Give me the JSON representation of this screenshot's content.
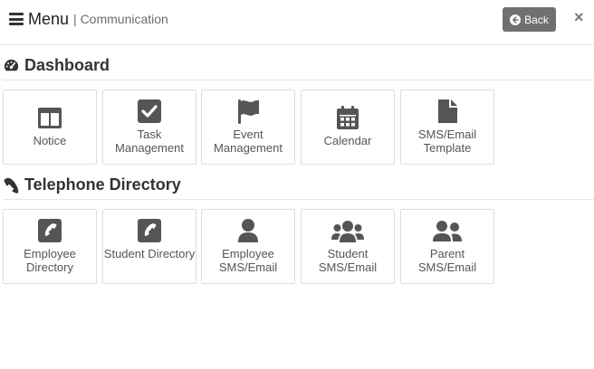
{
  "header": {
    "menu_label": "Menu",
    "separator": "|",
    "subtitle": "Communication",
    "back_label": "Back",
    "close_label": "×"
  },
  "sections": {
    "dashboard": {
      "title": "Dashboard",
      "icon": "tachometer-icon",
      "tiles": [
        {
          "label": "Notice",
          "icon": "columns-icon"
        },
        {
          "label": "Task Management",
          "icon": "check-square-icon"
        },
        {
          "label": "Event Management",
          "icon": "flag-icon"
        },
        {
          "label": "Calendar",
          "icon": "calendar-icon"
        },
        {
          "label": "SMS/Email Template",
          "icon": "file-icon"
        }
      ]
    },
    "directory": {
      "title": "Telephone Directory",
      "icon": "phone-icon",
      "tiles": [
        {
          "label": "Employee Directory",
          "icon": "phone-square-icon"
        },
        {
          "label": "Student Directory",
          "icon": "phone-square-icon"
        },
        {
          "label": "Employee SMS/Email",
          "icon": "user-icon"
        },
        {
          "label": "Student SMS/Email",
          "icon": "users-icon"
        },
        {
          "label": "Parent SMS/Email",
          "icon": "user-friends-icon"
        }
      ]
    }
  },
  "colors": {
    "icon": "#555555",
    "back_button": "#707070",
    "tile_border": "#dddddd"
  }
}
